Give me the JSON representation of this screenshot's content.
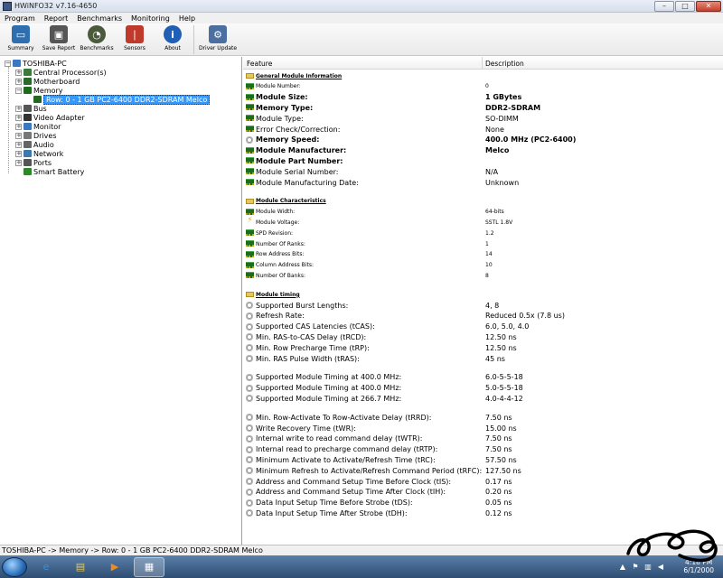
{
  "window": {
    "title": "HWiNFO32 v7.16-4650",
    "min": "–",
    "max": "□",
    "close": "✕"
  },
  "menu": [
    "Program",
    "Report",
    "Benchmarks",
    "Monitoring",
    "Help"
  ],
  "toolbar": [
    {
      "label": "Summary",
      "icon": "monitor-icon",
      "color": "#2f6fb0"
    },
    {
      "label": "Save Report",
      "icon": "floppy-icon",
      "color": "#555555"
    },
    {
      "label": "Benchmarks",
      "icon": "gauge-icon",
      "color": "#4a5a3a"
    },
    {
      "label": "Sensors",
      "icon": "thermometer-icon",
      "color": "#c0392b"
    },
    {
      "label": "About",
      "icon": "info-icon",
      "color": "#1f5fb5"
    },
    {
      "label": "Driver Update",
      "icon": "driver-update-icon",
      "color": "#4a6fa0"
    }
  ],
  "tree": {
    "root": "TOSHIBA-PC",
    "nodes": [
      {
        "label": "Central Processor(s)",
        "expander": "+",
        "color": "#3a7a3a"
      },
      {
        "label": "Motherboard",
        "expander": "+",
        "color": "#2a6a2a"
      },
      {
        "label": "Memory",
        "expander": "−",
        "color": "#1e6b1e"
      },
      {
        "label": "Row: 0 - 1 GB PC2-6400 DDR2-SDRAM Melco",
        "expander": "",
        "color": "#1e6b1e",
        "selected": true
      },
      {
        "label": "Bus",
        "expander": "+",
        "color": "#555555"
      },
      {
        "label": "Video Adapter",
        "expander": "+",
        "color": "#333333"
      },
      {
        "label": "Monitor",
        "expander": "+",
        "color": "#3a78c0"
      },
      {
        "label": "Drives",
        "expander": "+",
        "color": "#777777"
      },
      {
        "label": "Audio",
        "expander": "+",
        "color": "#666666"
      },
      {
        "label": "Network",
        "expander": "+",
        "color": "#3a7ab0"
      },
      {
        "label": "Ports",
        "expander": "+",
        "color": "#555555"
      },
      {
        "label": "Smart Battery",
        "expander": "",
        "color": "#2a8a2a"
      }
    ]
  },
  "detail": {
    "col_feature": "Feature",
    "col_description": "Description",
    "rows": [
      {
        "type": "section",
        "feature": "General Module Information"
      },
      {
        "type": "small",
        "icon": "chip",
        "feature": "Module Number:",
        "value": "0"
      },
      {
        "type": "bold",
        "icon": "chip",
        "feature": "Module Size:",
        "value": "1 GBytes"
      },
      {
        "type": "bold",
        "icon": "chip",
        "feature": "Memory Type:",
        "value": "DDR2-SDRAM"
      },
      {
        "type": "normal",
        "icon": "chip",
        "feature": "Module Type:",
        "value": "SO-DIMM"
      },
      {
        "type": "normal",
        "icon": "chip",
        "feature": "Error Check/Correction:",
        "value": "None"
      },
      {
        "type": "bold",
        "icon": "clock",
        "feature": "Memory Speed:",
        "value": "400.0 MHz (PC2-6400)"
      },
      {
        "type": "bold",
        "icon": "chip",
        "feature": "Module Manufacturer:",
        "value": "Melco"
      },
      {
        "type": "bold",
        "icon": "chip",
        "feature": "Module Part Number:",
        "value": ""
      },
      {
        "type": "normal",
        "icon": "chip",
        "feature": "Module Serial Number:",
        "value": "N/A"
      },
      {
        "type": "normal",
        "icon": "chip",
        "feature": "Module Manufacturing Date:",
        "value": "Unknown"
      },
      {
        "type": "blank"
      },
      {
        "type": "section",
        "feature": "Module Characteristics"
      },
      {
        "type": "small",
        "icon": "chip",
        "feature": "Module Width:",
        "value": "64-bits"
      },
      {
        "type": "small",
        "icon": "bolt",
        "feature": "Module Voltage:",
        "value": "SSTL 1.8V"
      },
      {
        "type": "small",
        "icon": "chip",
        "feature": "SPD Revision:",
        "value": "1.2"
      },
      {
        "type": "small",
        "icon": "chip",
        "feature": "Number Of Ranks:",
        "value": "1"
      },
      {
        "type": "small",
        "icon": "chip",
        "feature": "Row Address Bits:",
        "value": "14"
      },
      {
        "type": "small",
        "icon": "chip",
        "feature": "Column Address Bits:",
        "value": "10"
      },
      {
        "type": "small",
        "icon": "chip",
        "feature": "Number Of Banks:",
        "value": "8"
      },
      {
        "type": "blank"
      },
      {
        "type": "section",
        "feature": "Module timing"
      },
      {
        "type": "normal",
        "icon": "clock",
        "feature": "Supported Burst Lengths:",
        "value": "4, 8"
      },
      {
        "type": "normal",
        "icon": "clock",
        "feature": "Refresh Rate:",
        "value": "Reduced 0.5x (7.8 us)"
      },
      {
        "type": "normal",
        "icon": "clock",
        "feature": "Supported CAS Latencies (tCAS):",
        "value": "6.0, 5.0, 4.0"
      },
      {
        "type": "normal",
        "icon": "clock",
        "feature": "Min. RAS-to-CAS Delay (tRCD):",
        "value": "12.50 ns"
      },
      {
        "type": "normal",
        "icon": "clock",
        "feature": "Min. Row Precharge Time (tRP):",
        "value": "12.50 ns"
      },
      {
        "type": "normal",
        "icon": "clock",
        "feature": "Min. RAS Pulse Width (tRAS):",
        "value": "45 ns"
      },
      {
        "type": "blank"
      },
      {
        "type": "normal",
        "icon": "clock",
        "feature": "Supported Module Timing at 400.0 MHz:",
        "value": "6.0-5-5-18"
      },
      {
        "type": "normal",
        "icon": "clock",
        "feature": "Supported Module Timing at 400.0 MHz:",
        "value": "5.0-5-5-18"
      },
      {
        "type": "normal",
        "icon": "clock",
        "feature": "Supported Module Timing at 266.7 MHz:",
        "value": "4.0-4-4-12"
      },
      {
        "type": "blank"
      },
      {
        "type": "normal",
        "icon": "clock",
        "feature": "Min. Row-Activate To Row-Activate Delay (tRRD):",
        "value": "7.50 ns"
      },
      {
        "type": "normal",
        "icon": "clock",
        "feature": "Write Recovery Time (tWR):",
        "value": "15.00 ns"
      },
      {
        "type": "normal",
        "icon": "clock",
        "feature": "Internal write to read command delay (tWTR):",
        "value": "7.50 ns"
      },
      {
        "type": "normal",
        "icon": "clock",
        "feature": "Internal read to precharge command delay (tRTP):",
        "value": "7.50 ns"
      },
      {
        "type": "normal",
        "icon": "clock",
        "feature": "Minimum Activate to Activate/Refresh Time (tRC):",
        "value": "57.50 ns"
      },
      {
        "type": "normal",
        "icon": "clock",
        "feature": "Minimum Refresh to Activate/Refresh Command Period (tRFC):",
        "value": "127.50 ns"
      },
      {
        "type": "normal",
        "icon": "clock",
        "feature": "Address and Command Setup Time Before Clock (tIS):",
        "value": "0.17 ns"
      },
      {
        "type": "normal",
        "icon": "clock",
        "feature": "Address and Command Setup Time After Clock (tIH):",
        "value": "0.20 ns"
      },
      {
        "type": "normal",
        "icon": "clock",
        "feature": "Data Input Setup Time Before Strobe (tDS):",
        "value": "0.05 ns"
      },
      {
        "type": "normal",
        "icon": "clock",
        "feature": "Data Input Setup Time After Strobe (tDH):",
        "value": "0.12 ns"
      }
    ]
  },
  "statusbar": {
    "path": "TOSHIBA-PC -> Memory -> Row: 0 - 1 GB PC2-6400 DDR2-SDRAM Melco"
  },
  "taskbar": {
    "items": [
      {
        "name": "ie-icon",
        "glyph": "e",
        "color": "#3a8fd8",
        "active": false
      },
      {
        "name": "explorer-folder-icon",
        "glyph": "▤",
        "color": "#e7c75a",
        "active": false
      },
      {
        "name": "media-player-icon",
        "glyph": "▶",
        "color": "#f08a24",
        "active": false
      },
      {
        "name": "hwinfo-task-icon",
        "glyph": "▦",
        "color": "#ffffff",
        "active": true
      }
    ],
    "time": "4:18 PM",
    "date": "6/1/2000"
  }
}
